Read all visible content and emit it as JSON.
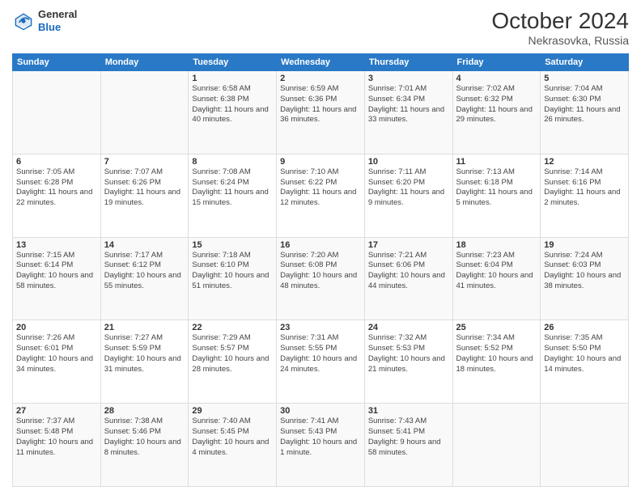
{
  "header": {
    "logo": {
      "general": "General",
      "blue": "Blue"
    },
    "month": "October 2024",
    "location": "Nekrasovka, Russia"
  },
  "days_of_week": [
    "Sunday",
    "Monday",
    "Tuesday",
    "Wednesday",
    "Thursday",
    "Friday",
    "Saturday"
  ],
  "weeks": [
    [
      {
        "day": "",
        "info": ""
      },
      {
        "day": "",
        "info": ""
      },
      {
        "day": "1",
        "info": "Sunrise: 6:58 AM\nSunset: 6:38 PM\nDaylight: 11 hours and 40 minutes."
      },
      {
        "day": "2",
        "info": "Sunrise: 6:59 AM\nSunset: 6:36 PM\nDaylight: 11 hours and 36 minutes."
      },
      {
        "day": "3",
        "info": "Sunrise: 7:01 AM\nSunset: 6:34 PM\nDaylight: 11 hours and 33 minutes."
      },
      {
        "day": "4",
        "info": "Sunrise: 7:02 AM\nSunset: 6:32 PM\nDaylight: 11 hours and 29 minutes."
      },
      {
        "day": "5",
        "info": "Sunrise: 7:04 AM\nSunset: 6:30 PM\nDaylight: 11 hours and 26 minutes."
      }
    ],
    [
      {
        "day": "6",
        "info": "Sunrise: 7:05 AM\nSunset: 6:28 PM\nDaylight: 11 hours and 22 minutes."
      },
      {
        "day": "7",
        "info": "Sunrise: 7:07 AM\nSunset: 6:26 PM\nDaylight: 11 hours and 19 minutes."
      },
      {
        "day": "8",
        "info": "Sunrise: 7:08 AM\nSunset: 6:24 PM\nDaylight: 11 hours and 15 minutes."
      },
      {
        "day": "9",
        "info": "Sunrise: 7:10 AM\nSunset: 6:22 PM\nDaylight: 11 hours and 12 minutes."
      },
      {
        "day": "10",
        "info": "Sunrise: 7:11 AM\nSunset: 6:20 PM\nDaylight: 11 hours and 9 minutes."
      },
      {
        "day": "11",
        "info": "Sunrise: 7:13 AM\nSunset: 6:18 PM\nDaylight: 11 hours and 5 minutes."
      },
      {
        "day": "12",
        "info": "Sunrise: 7:14 AM\nSunset: 6:16 PM\nDaylight: 11 hours and 2 minutes."
      }
    ],
    [
      {
        "day": "13",
        "info": "Sunrise: 7:15 AM\nSunset: 6:14 PM\nDaylight: 10 hours and 58 minutes."
      },
      {
        "day": "14",
        "info": "Sunrise: 7:17 AM\nSunset: 6:12 PM\nDaylight: 10 hours and 55 minutes."
      },
      {
        "day": "15",
        "info": "Sunrise: 7:18 AM\nSunset: 6:10 PM\nDaylight: 10 hours and 51 minutes."
      },
      {
        "day": "16",
        "info": "Sunrise: 7:20 AM\nSunset: 6:08 PM\nDaylight: 10 hours and 48 minutes."
      },
      {
        "day": "17",
        "info": "Sunrise: 7:21 AM\nSunset: 6:06 PM\nDaylight: 10 hours and 44 minutes."
      },
      {
        "day": "18",
        "info": "Sunrise: 7:23 AM\nSunset: 6:04 PM\nDaylight: 10 hours and 41 minutes."
      },
      {
        "day": "19",
        "info": "Sunrise: 7:24 AM\nSunset: 6:03 PM\nDaylight: 10 hours and 38 minutes."
      }
    ],
    [
      {
        "day": "20",
        "info": "Sunrise: 7:26 AM\nSunset: 6:01 PM\nDaylight: 10 hours and 34 minutes."
      },
      {
        "day": "21",
        "info": "Sunrise: 7:27 AM\nSunset: 5:59 PM\nDaylight: 10 hours and 31 minutes."
      },
      {
        "day": "22",
        "info": "Sunrise: 7:29 AM\nSunset: 5:57 PM\nDaylight: 10 hours and 28 minutes."
      },
      {
        "day": "23",
        "info": "Sunrise: 7:31 AM\nSunset: 5:55 PM\nDaylight: 10 hours and 24 minutes."
      },
      {
        "day": "24",
        "info": "Sunrise: 7:32 AM\nSunset: 5:53 PM\nDaylight: 10 hours and 21 minutes."
      },
      {
        "day": "25",
        "info": "Sunrise: 7:34 AM\nSunset: 5:52 PM\nDaylight: 10 hours and 18 minutes."
      },
      {
        "day": "26",
        "info": "Sunrise: 7:35 AM\nSunset: 5:50 PM\nDaylight: 10 hours and 14 minutes."
      }
    ],
    [
      {
        "day": "27",
        "info": "Sunrise: 7:37 AM\nSunset: 5:48 PM\nDaylight: 10 hours and 11 minutes."
      },
      {
        "day": "28",
        "info": "Sunrise: 7:38 AM\nSunset: 5:46 PM\nDaylight: 10 hours and 8 minutes."
      },
      {
        "day": "29",
        "info": "Sunrise: 7:40 AM\nSunset: 5:45 PM\nDaylight: 10 hours and 4 minutes."
      },
      {
        "day": "30",
        "info": "Sunrise: 7:41 AM\nSunset: 5:43 PM\nDaylight: 10 hours and 1 minute."
      },
      {
        "day": "31",
        "info": "Sunrise: 7:43 AM\nSunset: 5:41 PM\nDaylight: 9 hours and 58 minutes."
      },
      {
        "day": "",
        "info": ""
      },
      {
        "day": "",
        "info": ""
      }
    ]
  ]
}
